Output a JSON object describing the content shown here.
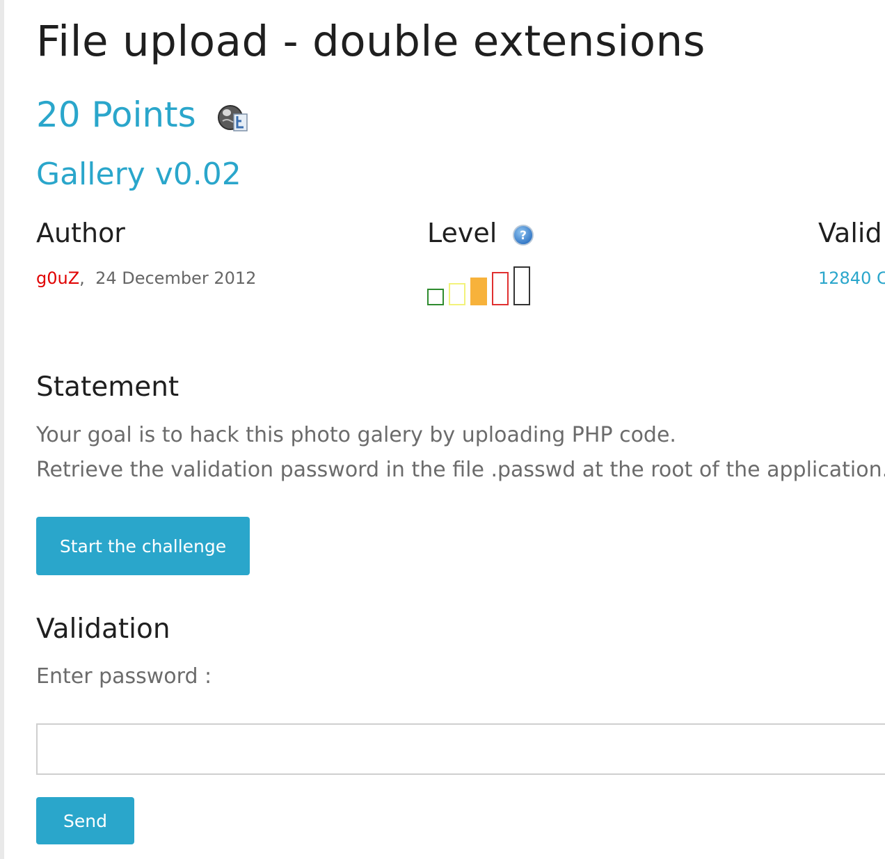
{
  "challenge": {
    "title": "File upload - double extensions",
    "points": "20 Points",
    "points_icon": "gallery-globe-icon",
    "subtitle": "Gallery v0.02"
  },
  "meta": {
    "author_heading": "Author",
    "author_name": "g0uZ",
    "author_separator": ",",
    "date": "24 December 2012",
    "level_heading": "Level",
    "level_help_icon": "question-mark-icon",
    "level_indicator": {
      "current_level": 3,
      "max_level": 5,
      "colors": [
        "#2e8b2e",
        "#f2f27a",
        "#f7b23b",
        "#e03030",
        "#333333"
      ]
    },
    "valid_heading": "Valid",
    "valid_count": "12840 C"
  },
  "statement": {
    "heading": "Statement",
    "lines": [
      "Your goal is to hack this photo galery by uploading PHP code.",
      "Retrieve the validation password in the file .passwd at the root of the application."
    ]
  },
  "actions": {
    "start_label": "Start the challenge"
  },
  "validation": {
    "heading": "Validation",
    "password_label": "Enter password :",
    "password_value": "",
    "send_label": "Send"
  },
  "colors": {
    "accent": "#2aa6cb",
    "author": "#e00000",
    "heading": "#1f1f1f",
    "body_text": "#6b6b6b"
  }
}
